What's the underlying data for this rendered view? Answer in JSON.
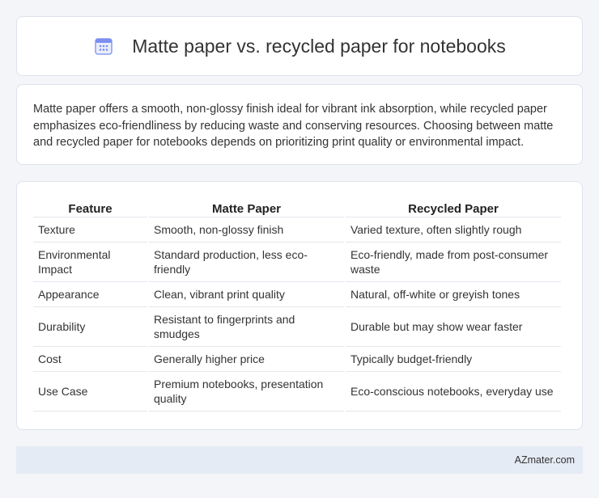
{
  "header": {
    "title": "Matte paper vs. recycled paper for notebooks",
    "icon": "calendar-icon",
    "icon_color": "#7b8ff0"
  },
  "intro": {
    "text": "Matte paper offers a smooth, non-glossy finish ideal for vibrant ink absorption, while recycled paper emphasizes eco-friendliness by reducing waste and conserving resources. Choosing between matte and recycled paper for notebooks depends on prioritizing print quality or environmental impact."
  },
  "table": {
    "columns": [
      "Feature",
      "Matte Paper",
      "Recycled Paper"
    ],
    "rows": [
      [
        "Texture",
        "Smooth, non-glossy finish",
        "Varied texture, often slightly rough"
      ],
      [
        "Environmental Impact",
        "Standard production, less eco-friendly",
        "Eco-friendly, made from post-consumer waste"
      ],
      [
        "Appearance",
        "Clean, vibrant print quality",
        "Natural, off-white or greyish tones"
      ],
      [
        "Durability",
        "Resistant to fingerprints and smudges",
        "Durable but may show wear faster"
      ],
      [
        "Cost",
        "Generally higher price",
        "Typically budget-friendly"
      ],
      [
        "Use Case",
        "Premium notebooks, presentation quality",
        "Eco-conscious notebooks, everyday use"
      ]
    ]
  },
  "footer": {
    "text": "AZmater.com"
  }
}
